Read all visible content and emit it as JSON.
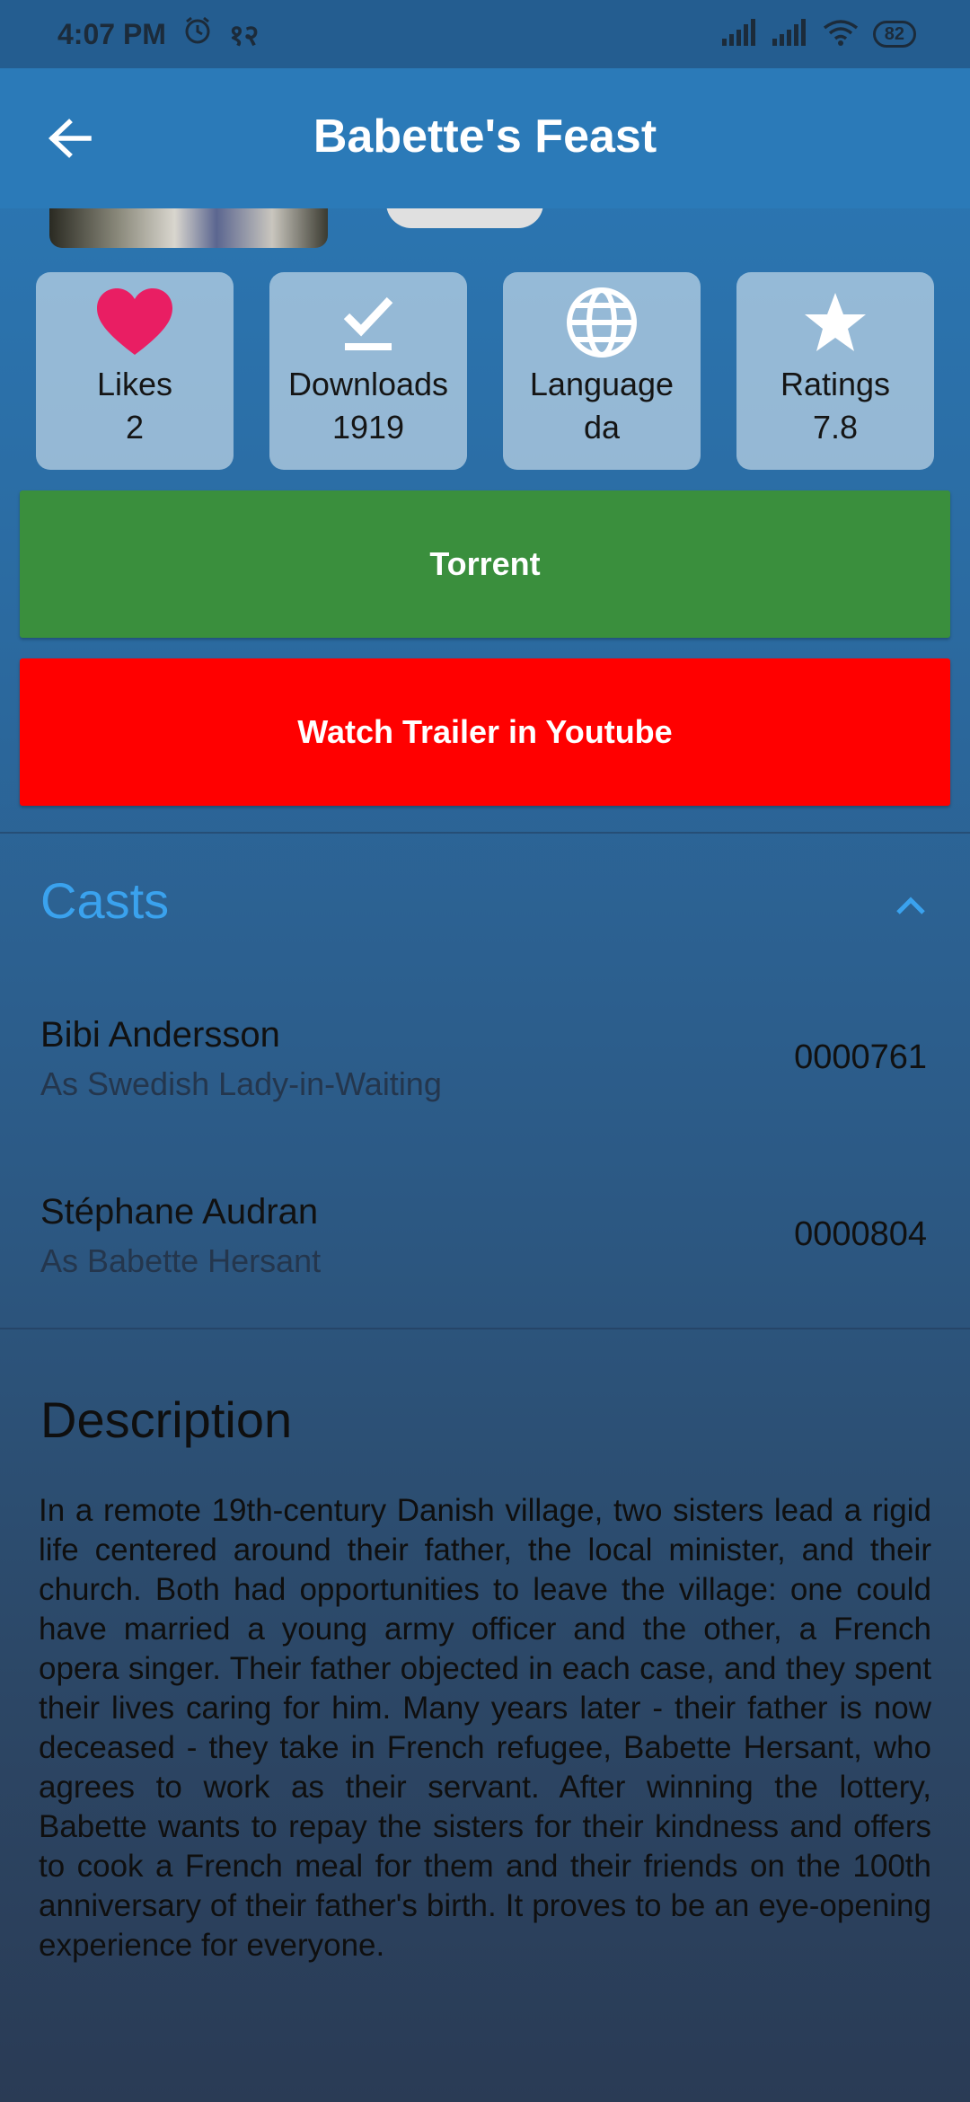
{
  "status_bar": {
    "time": "4:07 PM",
    "extra_glyph": "१२",
    "battery": "82",
    "icons": [
      "alarm-icon",
      "signal-icon",
      "signal-icon",
      "wifi-icon",
      "battery-icon"
    ]
  },
  "app_bar": {
    "title": "Babette's Feast",
    "back_icon": "arrow-left-icon"
  },
  "stats": [
    {
      "label": "Likes",
      "value": "2",
      "icon": "heart-icon",
      "icon_color": "#e91e63"
    },
    {
      "label": "Downloads",
      "value": "1919",
      "icon": "download-done-icon",
      "icon_color": "#ffffff"
    },
    {
      "label": "Language",
      "value": "da",
      "icon": "globe-icon",
      "icon_color": "#ffffff"
    },
    {
      "label": "Ratings",
      "value": "7.8",
      "icon": "star-icon",
      "icon_color": "#ffffff"
    }
  ],
  "buttons": {
    "torrent": "Torrent",
    "youtube": "Watch Trailer in Youtube",
    "torrent_color": "#3a8f3d",
    "youtube_color": "#ff0000"
  },
  "casts": {
    "title": "Casts",
    "title_color": "#3aa2ee",
    "items": [
      {
        "name": "Bibi Andersson",
        "role": "As  Swedish Lady-in-Waiting",
        "id": "0000761"
      },
      {
        "name": "Stéphane Audran",
        "role": "As  Babette Hersant",
        "id": "0000804"
      }
    ]
  },
  "description": {
    "title": "Description",
    "text": "In a remote 19th-century Danish village, two sisters lead a rigid life centered around their father, the local minister, and their church. Both had opportunities to leave the village: one could have married a young army officer and the other, a French opera singer. Their father objected in each case, and they spent their lives caring for him. Many years later - their father is now deceased - they take in French refugee, Babette Hersant, who agrees to work as their servant. After winning the lottery, Babette wants to repay the sisters for their kindness and offers to cook a French meal for them and their friends on the 100th anniversary of their father's birth. It proves to be an eye-opening experience for everyone."
  }
}
